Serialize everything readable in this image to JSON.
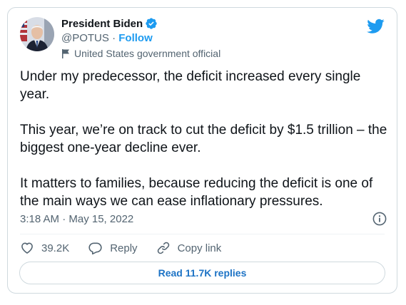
{
  "author": {
    "name": "President Biden",
    "handle": "@POTUS",
    "separator": " · ",
    "follow_label": "Follow",
    "label": "United States government official",
    "verified": true
  },
  "icons": {
    "avatar": "avatar",
    "verified": "verified-badge-icon",
    "label_flag": "flag-icon",
    "brand": "twitter-bird-icon",
    "info": "info-icon",
    "like": "heart-icon",
    "reply": "speech-bubble-icon",
    "copy": "link-icon"
  },
  "tweet": {
    "paragraphs": [
      "Under my predecessor, the deficit increased every single year.",
      "This year, we’re on track to cut the deficit by $1.5 trillion – the biggest one-year decline ever.",
      "It matters to families, because reducing the deficit is one of the main ways we can ease inflationary pressures."
    ],
    "timestamp": "3:18 AM · May 15, 2022"
  },
  "actions": {
    "likes": "39.2K",
    "reply_label": "Reply",
    "copy_label": "Copy link"
  },
  "read_replies_label": "Read 11.7K replies",
  "colors": {
    "accent": "#1d9bf0",
    "link_button_text": "#1d73c5",
    "text_primary": "#0f1419",
    "text_secondary": "#536471",
    "border": "#cfd9de"
  }
}
